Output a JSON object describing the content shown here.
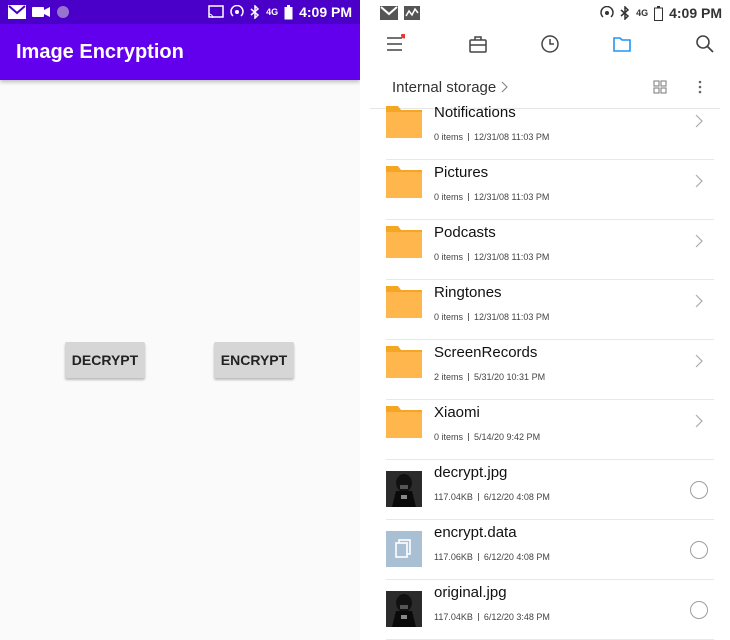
{
  "left_pane": {
    "status_time": "4:09 PM",
    "status_network": "4G",
    "app_title": "Image Encryption",
    "buttons": {
      "decrypt": "DECRYPT",
      "encrypt": "ENCRYPT"
    },
    "colors": {
      "app_bar": "#6200ee",
      "status_bar": "#4a00c8",
      "button_bg": "#d6d6d6"
    }
  },
  "right_pane": {
    "status_time": "4:09 PM",
    "status_network": "4G",
    "toolbar_icons": [
      "menu-icon",
      "toolbox-icon",
      "recent-clock-icon",
      "folder-icon",
      "search-icon"
    ],
    "notification_dot_color": "#e53935",
    "active_icon_color": "#2196f3",
    "breadcrumb": "Internal storage",
    "items": [
      {
        "name": "Notifications",
        "count": "0 items",
        "date": "12/31/08 11:03 PM",
        "type": "folder"
      },
      {
        "name": "Pictures",
        "count": "0 items",
        "date": "12/31/08 11:03 PM",
        "type": "folder"
      },
      {
        "name": "Podcasts",
        "count": "0 items",
        "date": "12/31/08 11:03 PM",
        "type": "folder"
      },
      {
        "name": "Ringtones",
        "count": "0 items",
        "date": "12/31/08 11:03 PM",
        "type": "folder"
      },
      {
        "name": "ScreenRecords",
        "count": "2 items",
        "date": "5/31/20 10:31 PM",
        "type": "folder"
      },
      {
        "name": "Xiaomi",
        "count": "0 items",
        "date": "5/14/20 9:42 PM",
        "type": "folder"
      },
      {
        "name": "decrypt.jpg",
        "count": "117.04KB",
        "date": "6/12/20 4:08 PM",
        "type": "image"
      },
      {
        "name": "encrypt.data",
        "count": "117.06KB",
        "date": "6/12/20 4:08 PM",
        "type": "file"
      },
      {
        "name": "original.jpg",
        "count": "117.04KB",
        "date": "6/12/20 3:48 PM",
        "type": "image"
      }
    ],
    "colors": {
      "folder": "#ffb74d",
      "folder_tab": "#f5a623",
      "file_icon_bg": "#a9bfd4"
    }
  }
}
